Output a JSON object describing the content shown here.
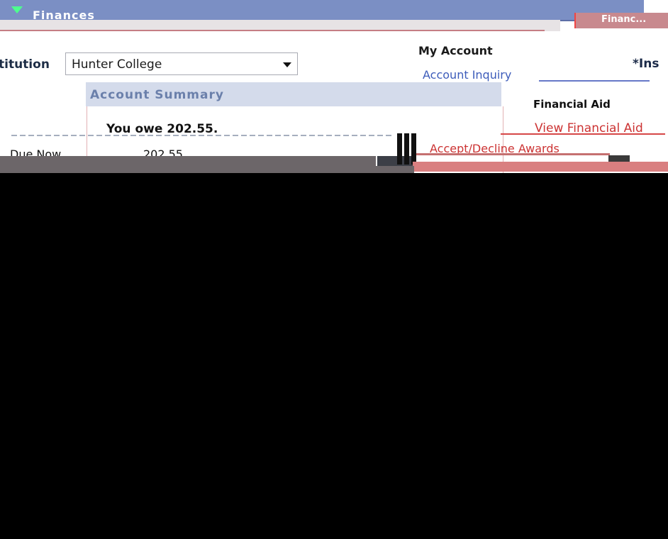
{
  "header": {
    "title": "Finances",
    "right_strip_label": "Financ..."
  },
  "institution": {
    "label": "titution",
    "value": "Hunter College"
  },
  "account_summary": {
    "title": "Account Summary",
    "owe_text": "You owe 202.55.",
    "due_label": "Due Now",
    "due_value": "202.55"
  },
  "my_account": {
    "title": "My Account",
    "link": "Account Inquiry",
    "institution_star": "*Ins"
  },
  "financial_aid": {
    "title": "Financial Aid",
    "view_link": "View Financial Aid",
    "accept_link": "Accept/Decline Awards"
  }
}
